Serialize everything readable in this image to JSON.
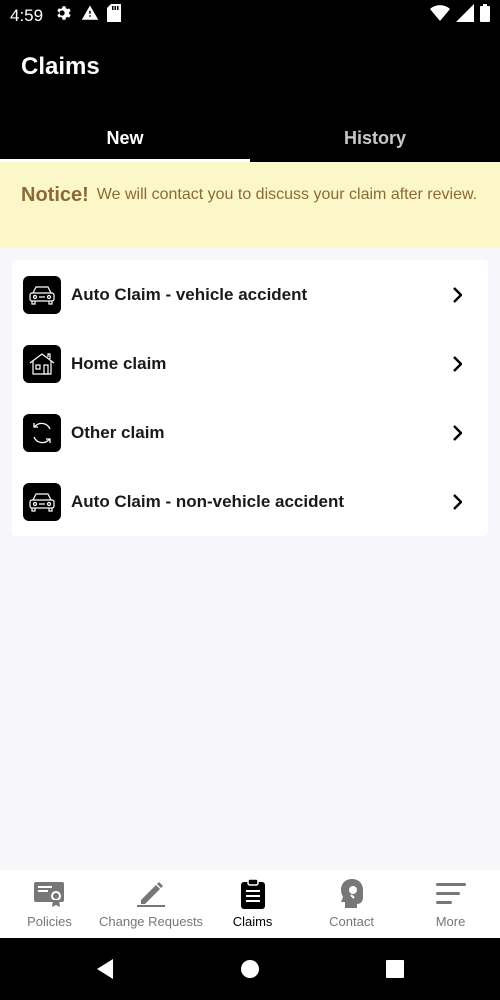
{
  "status_bar": {
    "time": "4:59",
    "icons": [
      "gear-icon",
      "warning-icon",
      "sd-card-icon",
      "wifi-icon",
      "signal-icon",
      "battery-icon"
    ]
  },
  "app_bar": {
    "title": "Claims",
    "tabs": [
      {
        "label": "New",
        "active": true
      },
      {
        "label": "History",
        "active": false
      }
    ]
  },
  "notice": {
    "label": "Notice!",
    "text": "We will contact you to discuss your claim after review."
  },
  "claims": {
    "items": [
      {
        "label": "Auto Claim - vehicle accident",
        "icon": "car-icon"
      },
      {
        "label": "Home claim",
        "icon": "house-icon"
      },
      {
        "label": "Other claim",
        "icon": "refresh-icon"
      },
      {
        "label": "Auto Claim - non-vehicle accident",
        "icon": "car-icon"
      }
    ]
  },
  "bottom_nav": {
    "items": [
      {
        "label": "Policies",
        "icon": "certificate-icon",
        "active": false
      },
      {
        "label": "Change Requests",
        "icon": "pen-icon",
        "active": false
      },
      {
        "label": "Claims",
        "icon": "clipboard-icon",
        "active": true
      },
      {
        "label": "Contact",
        "icon": "support-head-icon",
        "active": false
      },
      {
        "label": "More",
        "icon": "menu-lines-icon",
        "active": false
      }
    ]
  },
  "colors": {
    "app_bar": "#000000",
    "notice_bg": "#fbf7c8",
    "notice_text": "#8b6a36",
    "page_bg": "#f7f6fa",
    "active_nav": "#000000",
    "inactive_nav": "#777777"
  }
}
